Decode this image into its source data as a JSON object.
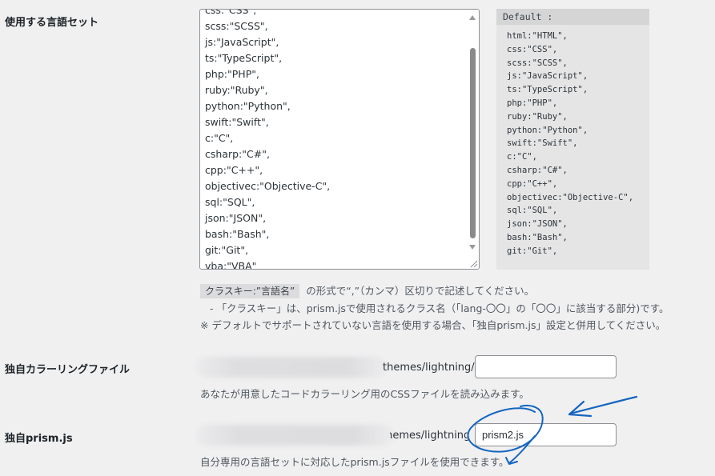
{
  "languages": {
    "label": "使用する言語セット",
    "textarea_lines": [
      "css:\"CSS\",",
      "scss:\"SCSS\",",
      "js:\"JavaScript\",",
      "ts:\"TypeScript\",",
      "php:\"PHP\",",
      "ruby:\"Ruby\",",
      "python:\"Python\",",
      "swift:\"Swift\",",
      "c:\"C\",",
      "csharp:\"C#\",",
      "cpp:\"C++\",",
      "objectivec:\"Objective-C\",",
      "sql:\"SQL\",",
      "json:\"JSON\",",
      "bash:\"Bash\",",
      "git:\"Git\",",
      "vba:\"VBA\""
    ],
    "default_title": "Default :",
    "default_lines": [
      "html:\"HTML\",",
      "css:\"CSS\",",
      "scss:\"SCSS\",",
      "js:\"JavaScript\",",
      "ts:\"TypeScript\",",
      "php:\"PHP\",",
      "ruby:\"Ruby\",",
      "python:\"Python\",",
      "swift:\"Swift\",",
      "c:\"C\",",
      "csharp:\"C#\",",
      "cpp:\"C++\",",
      "objectivec:\"Objective-C\",",
      "sql:\"SQL\",",
      "json:\"JSON\",",
      "bash:\"Bash\",",
      "git:\"Git\","
    ],
    "format_code": "クラスキー:”言語名”",
    "format_text": "の形式で“,”（カンマ）区切りで記述してください。",
    "note1": "- 「クラスキー」は、prism.jsで使用されるクラス名（「lang-〇〇」の「〇〇」に該当する部分)です。",
    "note2": "※ デフォルトでサポートされていない言語を使用する場合、「独自prism.js」設定と併用してください。"
  },
  "color_file": {
    "label": "独自カラーリングファイル",
    "path": "themes/lightning/",
    "value": "",
    "desc": "あなたが用意したコードカラーリング用のCSSファイルを読み込みます。"
  },
  "prism": {
    "label": "独自prism.js",
    "path": "themes/lightning/",
    "value": "prism2.js",
    "desc": "自分専用の言語セットに対応したprism.jsファイルを使用できます。"
  },
  "colors": {
    "annotation": "#1565c0"
  }
}
